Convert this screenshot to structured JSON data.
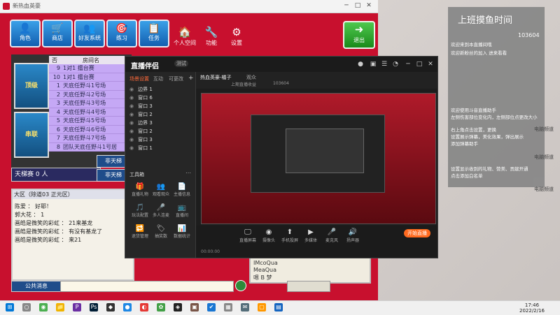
{
  "game": {
    "title": "新热血英豪",
    "buttons": [
      {
        "label": "角色",
        "glyph": "👤"
      },
      {
        "label": "商店",
        "glyph": "🛒"
      },
      {
        "label": "好友系统",
        "glyph": "👥"
      },
      {
        "label": "练习",
        "glyph": "🎯"
      },
      {
        "label": "任务",
        "glyph": "📋"
      }
    ],
    "buttons2": [
      {
        "label": "个人空间",
        "glyph": "🏠"
      },
      {
        "label": "功能",
        "glyph": "🔧"
      },
      {
        "label": "设置",
        "glyph": "⚙"
      }
    ],
    "exit_label": "退出",
    "exit_glyph": "➜",
    "room_header": {
      "col1": "否",
      "col2": "房间名"
    },
    "rooms": [
      {
        "n": "9",
        "t": "1对1 擂台赛"
      },
      {
        "n": "10",
        "t": "1对1 擂台赛"
      },
      {
        "n": "1",
        "t": "天底任野斗1号场"
      },
      {
        "n": "2",
        "t": "天底任野斗2号场"
      },
      {
        "n": "3",
        "t": "天底任野斗3号场"
      },
      {
        "n": "4",
        "t": "天底任野斗4号场"
      },
      {
        "n": "5",
        "t": "天底任野斗5号场"
      },
      {
        "n": "6",
        "t": "天底任野斗6号场"
      },
      {
        "n": "7",
        "t": "天底任野斗7号场"
      },
      {
        "n": "8",
        "t": "团队天底任野斗1号居"
      }
    ],
    "card1": "顶级",
    "card2": "串联",
    "tianti": "天梯赛  0  人",
    "side1": "非天梯",
    "side2": "非天梯",
    "chat_header": "大区（除道03 正元区）",
    "chat": [
      "陈爱 ：  好耶！",
      "郭大花 ：  1",
      "画皓是微笑的彩虹 ：  21来基龙",
      "画皓是微笑的彩虹 ：  有没有基龙了",
      "画皓是微笑的彩虹 ：  来21"
    ],
    "public_msg": "公共消息",
    "players": [
      "IMcoQua",
      "MeaQua",
      "嗯 B 梦"
    ]
  },
  "stream": {
    "app_name": "直播伴侣",
    "version": "测试",
    "tabs": [
      "场景设置",
      "互动",
      "可更改"
    ],
    "sources": [
      {
        "n": "边界 1"
      },
      {
        "n": "窗口 6"
      },
      {
        "n": "窗口 3"
      },
      {
        "n": "窗口 2"
      },
      {
        "n": "边界 3"
      },
      {
        "n": "窗口 2"
      },
      {
        "n": "窗口 3"
      },
      {
        "n": "窗口 1"
      }
    ],
    "workbench": "工具箱",
    "tools": [
      {
        "g": "🎁",
        "l": "直播礼物"
      },
      {
        "g": "👥",
        "l": "观看观众"
      },
      {
        "g": "📄",
        "l": "主播信息"
      },
      {
        "g": "🎵",
        "l": "玩法配置"
      },
      {
        "g": "🎤",
        "l": "多人连麦"
      },
      {
        "g": "📺",
        "l": "直播间"
      },
      {
        "g": "🔁",
        "l": "退货管理"
      },
      {
        "g": "🏷",
        "l": "抽奖数"
      },
      {
        "g": "📊",
        "l": "数据统计"
      }
    ],
    "info1": "热血英豪-橘子",
    "info2": "观众",
    "info3": "上期直播收益",
    "stream_id": "103604",
    "controls": [
      {
        "g": "🖵",
        "l": "直播屏幕"
      },
      {
        "g": "◉",
        "l": "摄像头"
      },
      {
        "g": "⬆",
        "l": "手机投屏"
      },
      {
        "g": "▶",
        "l": "多媒体"
      },
      {
        "g": "🎤",
        "l": "麦克风"
      },
      {
        "g": "🔊",
        "l": "扬声器"
      }
    ],
    "start_live": "开始直播",
    "status": "00:00:00"
  },
  "livechat": {
    "title": "上班摸鱼时间",
    "id": "103604",
    "messages": [
      "欢迎来到本直播间哦",
      "欢迎新粉丝的加入 进来看看",
      "欢迎使用斗音直播助手",
      "左侧伤害部位变化内，左侧部位点更改大小",
      "右上角点击设置，更换",
      "设置展示弹幕，美化效果，弹出展示",
      "添加弹幕助手"
    ],
    "messages2": [
      "设置显示收到的礼物、赞美、贡献开通",
      "点击添加白名单"
    ]
  },
  "desktop": {
    "icons": [
      "电脑频道",
      "电脑频道",
      "电脑频道"
    ]
  },
  "taskbar": {
    "icons": [
      {
        "g": "⊞",
        "c": "#0078d7"
      },
      {
        "g": "○",
        "c": "#888"
      },
      {
        "g": "◉",
        "c": "#4caf50"
      },
      {
        "g": "📁",
        "c": "#f0b400"
      },
      {
        "g": "P",
        "c": "#6b2fa3"
      },
      {
        "g": "Ps",
        "c": "#001e36"
      },
      {
        "g": "◆",
        "c": "#333"
      },
      {
        "g": "●",
        "c": "#1e88e5"
      },
      {
        "g": "◐",
        "c": "#e53935"
      },
      {
        "g": "✿",
        "c": "#43a047"
      },
      {
        "g": "◈",
        "c": "#222"
      },
      {
        "g": "▣",
        "c": "#795548"
      },
      {
        "g": "✔",
        "c": "#1976d2"
      },
      {
        "g": "▦",
        "c": "#888"
      },
      {
        "g": "✉",
        "c": "#546e7a"
      },
      {
        "g": "▢",
        "c": "#ff9800"
      },
      {
        "g": "▤",
        "c": "#1565c0"
      }
    ],
    "time": "17:46",
    "date": "2022/2/16"
  }
}
